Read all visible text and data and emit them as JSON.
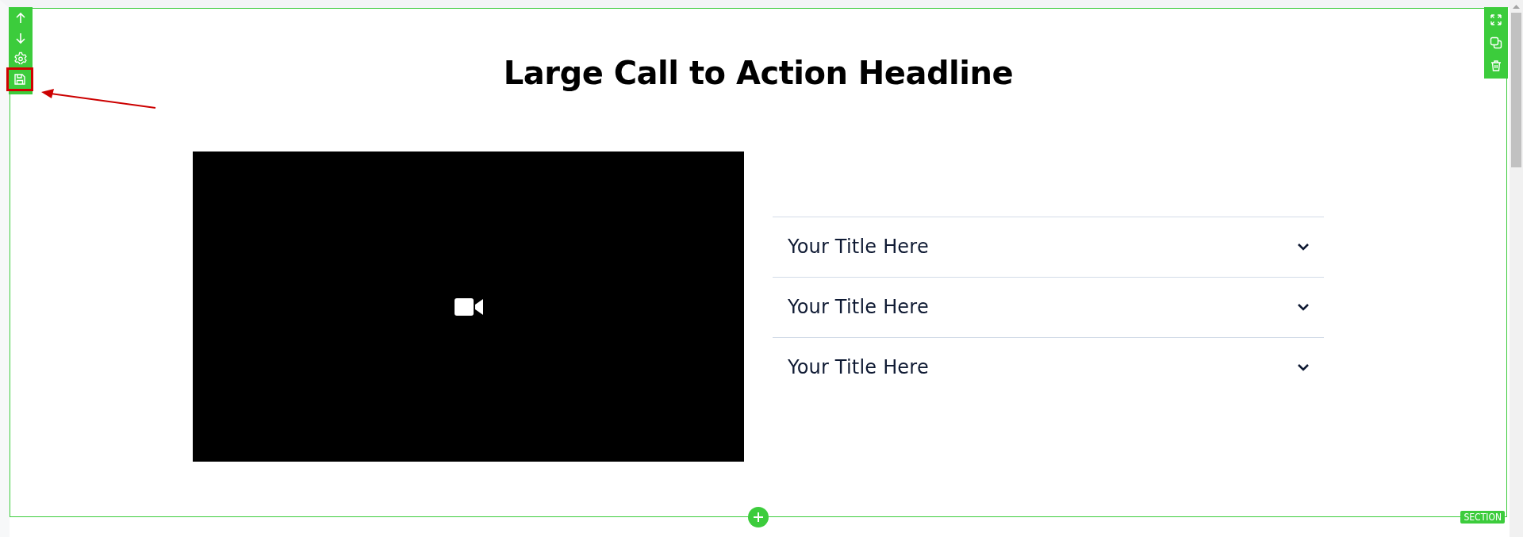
{
  "left_toolbar": [
    {
      "kind": "up",
      "highlighted": false
    },
    {
      "kind": "down",
      "highlighted": false
    },
    {
      "kind": "settings",
      "highlighted": false
    },
    {
      "kind": "save",
      "highlighted": true
    }
  ],
  "right_toolbar": [
    {
      "kind": "expand"
    },
    {
      "kind": "duplicate"
    },
    {
      "kind": "delete"
    }
  ],
  "headline": "Large Call to Action Headline",
  "accordion": [
    {
      "title": "Your Title Here",
      "expanded": false
    },
    {
      "title": "Your Title Here",
      "expanded": false
    },
    {
      "title": "Your Title Here",
      "expanded": false
    }
  ],
  "section_label": "SECTION"
}
